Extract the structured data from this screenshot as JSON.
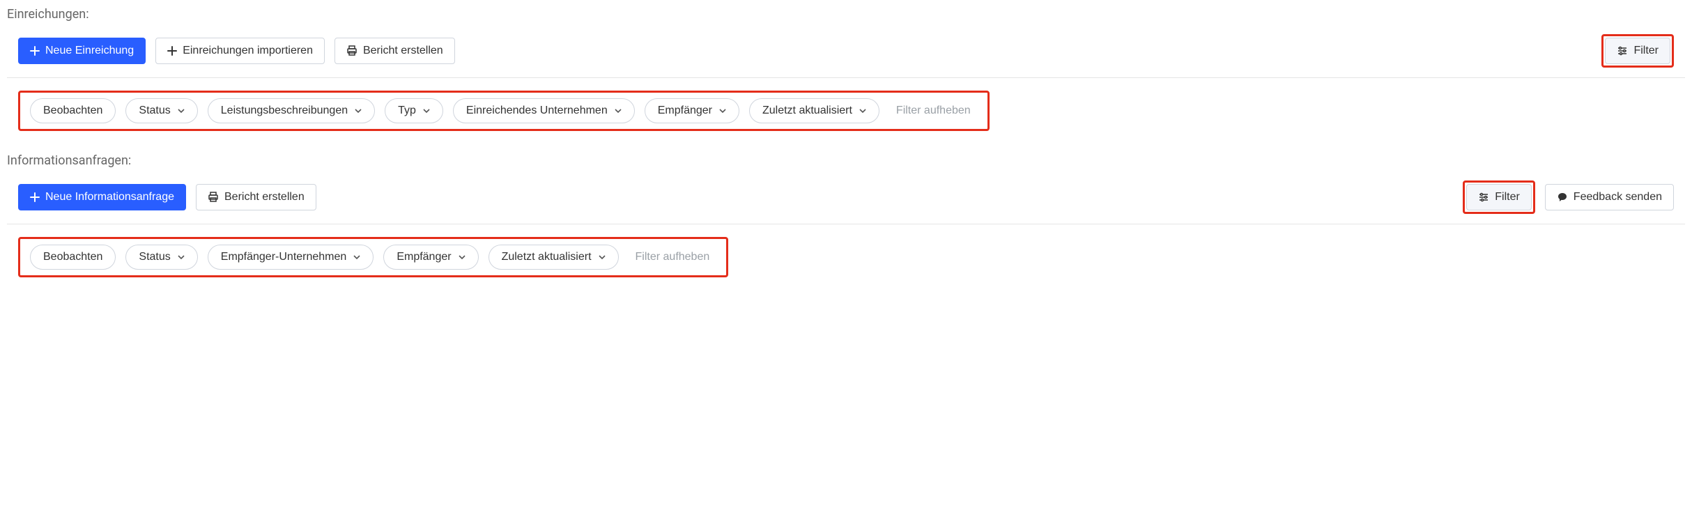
{
  "sections": {
    "submissions": {
      "title": "Einreichungen:",
      "buttons": {
        "new": "Neue Einreichung",
        "import": "Einreichungen importieren",
        "report": "Bericht erstellen",
        "filter": "Filter"
      },
      "filters": {
        "watch": "Beobachten",
        "status": "Status",
        "descriptions": "Leistungsbeschreibungen",
        "type": "Typ",
        "submitting_company": "Einreichendes Unternehmen",
        "recipient": "Empfänger",
        "last_updated": "Zuletzt aktualisiert",
        "clear": "Filter aufheben"
      }
    },
    "info_requests": {
      "title": "Informationsanfragen:",
      "buttons": {
        "new": "Neue Informationsanfrage",
        "report": "Bericht erstellen",
        "filter": "Filter",
        "feedback": "Feedback senden"
      },
      "filters": {
        "watch": "Beobachten",
        "status": "Status",
        "recipient_company": "Empfänger-Unternehmen",
        "recipient": "Empfänger",
        "last_updated": "Zuletzt aktualisiert",
        "clear": "Filter aufheben"
      }
    }
  }
}
